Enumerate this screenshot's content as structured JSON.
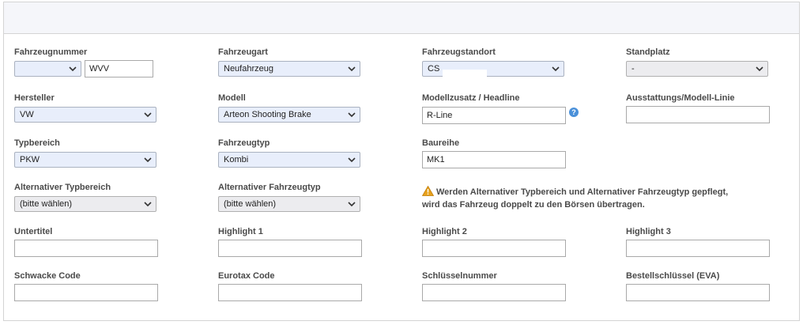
{
  "form": {
    "fahrzeugnummer": {
      "label": "Fahrzeugnummer",
      "select_value": "",
      "input_value": "WVV"
    },
    "fahrzeugart": {
      "label": "Fahrzeugart",
      "value": "Neufahrzeug"
    },
    "fahrzeugstandort": {
      "label": "Fahrzeugstandort",
      "value": "CS"
    },
    "standplatz": {
      "label": "Standplatz",
      "value": "-"
    },
    "hersteller": {
      "label": "Hersteller",
      "value": "VW"
    },
    "modell": {
      "label": "Modell",
      "value": "Arteon Shooting Brake"
    },
    "modellzusatz": {
      "label": "Modellzusatz / Headline",
      "value": "R-Line"
    },
    "ausstattung": {
      "label": "Ausstattungs/Modell-Linie",
      "value": ""
    },
    "typbereich": {
      "label": "Typbereich",
      "value": "PKW"
    },
    "fahrzeugtyp": {
      "label": "Fahrzeugtyp",
      "value": "Kombi"
    },
    "baureihe": {
      "label": "Baureihe",
      "value": "MK1"
    },
    "alt_typbereich": {
      "label": "Alternativer Typbereich",
      "value": "(bitte wählen)"
    },
    "alt_fahrzeugtyp": {
      "label": "Alternativer Fahrzeugtyp",
      "value": "(bitte wählen)"
    },
    "warning": {
      "line1": "Werden Alternativer Typbereich und Alternativer Fahrzeugtyp gepflegt,",
      "line2": "wird das Fahrzeug doppelt zu den Börsen übertragen."
    },
    "untertitel": {
      "label": "Untertitel",
      "value": ""
    },
    "highlight1": {
      "label": "Highlight 1",
      "value": ""
    },
    "highlight2": {
      "label": "Highlight 2",
      "value": ""
    },
    "highlight3": {
      "label": "Highlight 3",
      "value": ""
    },
    "schwacke": {
      "label": "Schwacke Code",
      "value": ""
    },
    "eurotax": {
      "label": "Eurotax Code",
      "value": ""
    },
    "schluesselnummer": {
      "label": "Schlüsselnummer",
      "value": ""
    },
    "bestellschluessel": {
      "label": "Bestellschlüssel (EVA)",
      "value": ""
    }
  },
  "help_icon_text": "?",
  "colors": {
    "select_bg": "#e8eefb",
    "select_disabled_bg": "#ececef",
    "help_icon": "#4a90d9",
    "warning_icon": "#e8a21c"
  },
  "icons": {
    "chevron": "chevron-down-icon",
    "help": "help-icon",
    "warning": "warning-icon"
  }
}
